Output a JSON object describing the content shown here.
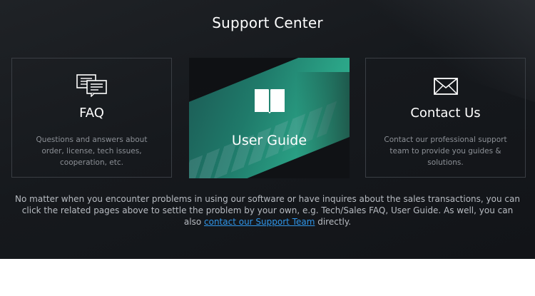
{
  "page": {
    "title": "Support Center"
  },
  "cards": {
    "faq": {
      "icon": "chat-bubbles-icon",
      "heading": "FAQ",
      "description": "Questions and answers about order, license, tech issues, cooperation, etc."
    },
    "guide": {
      "icon": "open-book-icon",
      "heading": "User Guide"
    },
    "contact": {
      "icon": "envelope-icon",
      "heading": "Contact Us",
      "description": "Contact our professional support team to provide you guides & solutions."
    }
  },
  "footer": {
    "text_before": "No matter when you encounter problems in using our software or have inquires about the sales transactions, you can click the related pages above to settle the problem by your own, e.g. Tech/Sales FAQ, User Guide. As well, you can also ",
    "link_text": "contact our Support Team",
    "text_after": " directly."
  },
  "colors": {
    "background": "#16191d",
    "link": "#2f95e8",
    "accent_green": "#2ba487"
  }
}
